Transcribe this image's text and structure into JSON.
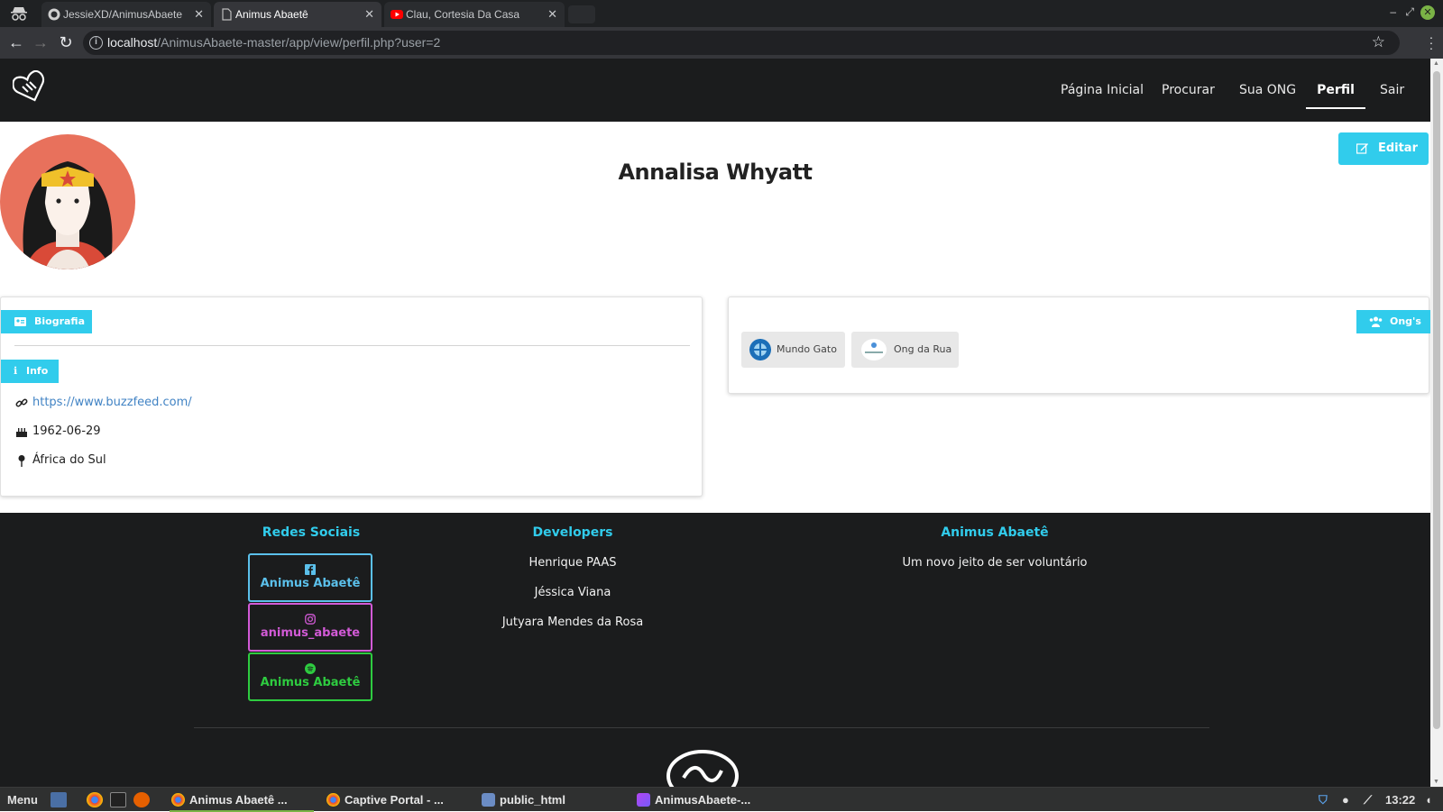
{
  "browser": {
    "tabs": [
      {
        "label": "JessieXD/AnimusAbaete",
        "icon": "github-icon",
        "active": false
      },
      {
        "label": "Animus Abaetê",
        "icon": "page-icon",
        "active": true
      },
      {
        "label": "Clau, Cortesia Da Casa",
        "icon": "youtube-icon",
        "active": false
      }
    ],
    "url_host": "localhost",
    "url_path": "/AnimusAbaete-master/app/view/perfil.php?user=2"
  },
  "navbar": {
    "items": [
      "Página Inicial",
      "Procurar",
      "Sua ONG",
      "Perfil",
      "Sair"
    ],
    "active": "Perfil"
  },
  "profile": {
    "name": "Annalisa Whyatt",
    "edit_label": "Editar"
  },
  "bio_card": {
    "bio_label": "Biografia",
    "info_label": "Info",
    "website": "https://www.buzzfeed.com/",
    "birthdate": "1962-06-29",
    "location": "África do Sul"
  },
  "ongs_card": {
    "label": "Ong's",
    "ongs": [
      {
        "name": "Mundo Gato",
        "icon": "mundo-gato-logo"
      },
      {
        "name": "Ong da Rua",
        "icon": "ong-da-rua-logo"
      }
    ]
  },
  "footer": {
    "social_heading": "Redes Sociais",
    "social": [
      {
        "label": "Animus Abaetê",
        "icon": "facebook-icon",
        "color": "#5bc0eb"
      },
      {
        "label": "animus_abaete",
        "icon": "instagram-icon",
        "color": "#d25ad6"
      },
      {
        "label": "Animus Abaetê",
        "icon": "spotify-icon",
        "color": "#2ecc40"
      }
    ],
    "dev_heading": "Developers",
    "developers": [
      "Henrique PAAS",
      "Jéssica Viana",
      "Jutyara Mendes da Rosa"
    ],
    "about_heading": "Animus Abaetê",
    "tagline": "Um novo jeito de ser voluntário"
  },
  "taskbar": {
    "menu_label": "Menu",
    "windows": [
      {
        "label": "Animus Abaetê ...",
        "icon": "chrome-icon",
        "active": true
      },
      {
        "label": "Captive Portal - ...",
        "icon": "chrome-icon",
        "active": false
      },
      {
        "label": "public_html",
        "icon": "folder-icon",
        "active": false
      },
      {
        "label": "AnimusAbaete-...",
        "icon": "phpstorm-icon",
        "active": false
      }
    ],
    "time": "13:22"
  },
  "colors": {
    "accent": "#31ccec",
    "navbar_bg": "#1b1c1d",
    "link": "#4183c4"
  }
}
